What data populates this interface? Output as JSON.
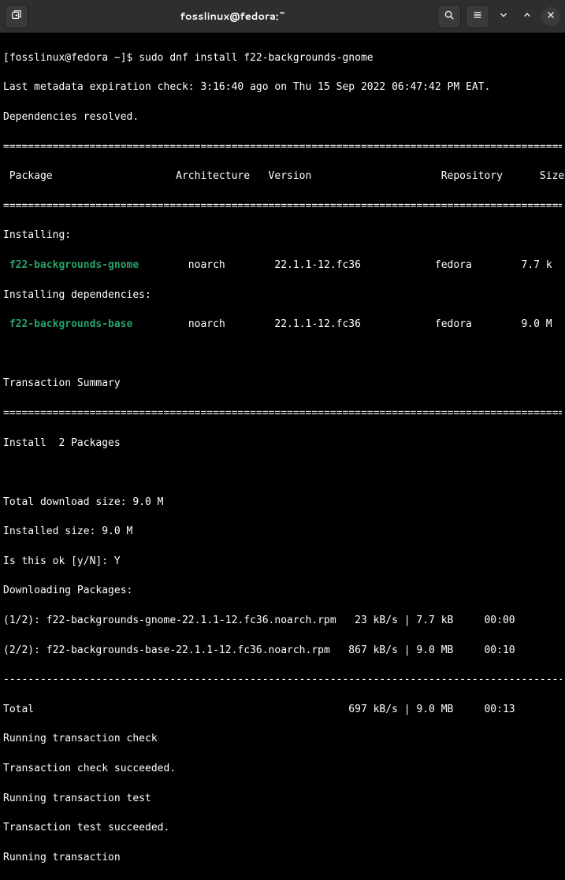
{
  "titlebar": {
    "title": "fosslinux@fedora:~"
  },
  "prompt": {
    "text": "[fosslinux@fedora ~]$ ",
    "command": "sudo dnf install f22-backgrounds-gnome"
  },
  "meta": {
    "expiration": "Last metadata expiration check: 3:16:40 ago on Thu 15 Sep 2022 06:47:42 PM EAT.",
    "deps_resolved": "Dependencies resolved."
  },
  "rules": {
    "dbl": "=============================================================================================================",
    "single": "-------------------------------------------------------------------------------------------------------------"
  },
  "table": {
    "header": " Package                    Architecture   Version                     Repository      Size"
  },
  "install": {
    "heading": "Installing:",
    "pkg1": {
      "name": " f22-backgrounds-gnome",
      "rest": "        noarch        22.1.1-12.fc36            fedora        7.7 k"
    },
    "deps_heading": "Installing dependencies:",
    "pkg2": {
      "name": " f22-backgrounds-base",
      "rest": "         noarch        22.1.1-12.fc36            fedora        9.0 M"
    }
  },
  "summary": {
    "heading": "Transaction Summary",
    "install_count": "Install  2 Packages",
    "dl_size": "Total download size: 9.0 M",
    "inst_size": "Installed size: 9.0 M",
    "confirm": "Is this ok [y/N]: Y",
    "downloading": "Downloading Packages:"
  },
  "downloads": {
    "row1": "(1/2): f22-backgrounds-gnome-22.1.1-12.fc36.noarch.rpm   23 kB/s | 7.7 kB     00:00",
    "row2": "(2/2): f22-backgrounds-base-22.1.1-12.fc36.noarch.rpm   867 kB/s | 9.0 MB     00:10",
    "total": "Total                                                   697 kB/s | 9.0 MB     00:13"
  },
  "tx": {
    "check": "Running transaction check",
    "check_ok": "Transaction check succeeded.",
    "test": "Running transaction test",
    "test_ok": "Transaction test succeeded.",
    "run": "Running transaction"
  }
}
